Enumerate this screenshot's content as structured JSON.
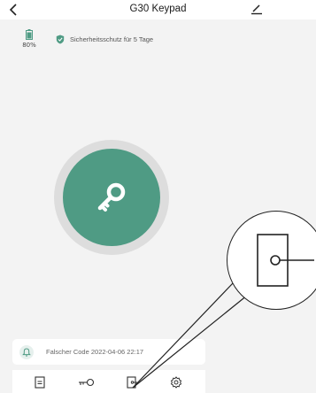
{
  "header": {
    "title": "G30 Keypad",
    "back_icon": "chevron-left-icon",
    "edit_icon": "pencil-icon"
  },
  "status": {
    "battery_label": "80%",
    "battery_icon": "battery-icon",
    "battery_level": 0.8,
    "security_text": "Sicherheitsschutz für 5 Tage",
    "security_icon": "shield-check-icon"
  },
  "unlock": {
    "icon": "key-icon"
  },
  "notification": {
    "icon": "bell-icon",
    "text": "Falscher Code 2022-04-06 22:17"
  },
  "tabbar": {
    "items": [
      {
        "icon": "log-icon"
      },
      {
        "icon": "key-icon"
      },
      {
        "icon": "door-icon"
      },
      {
        "icon": "settings-icon"
      }
    ]
  },
  "colors": {
    "accent": "#4f9b84",
    "ring": "#dddddd",
    "background": "#f3f3f3"
  }
}
